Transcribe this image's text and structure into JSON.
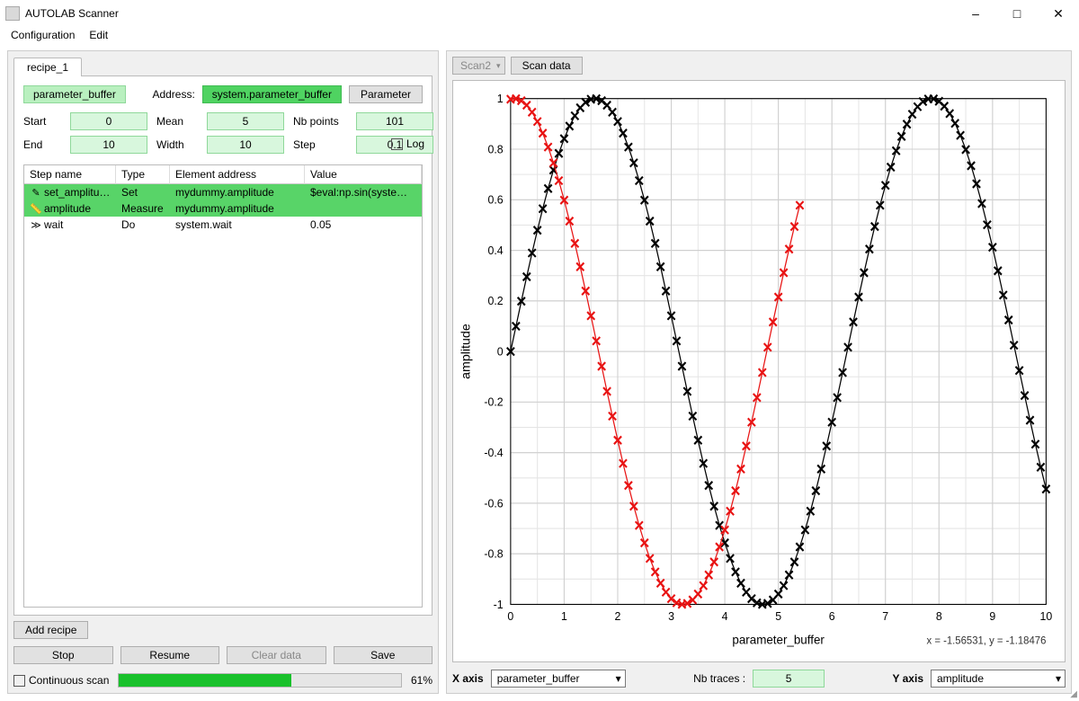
{
  "window": {
    "title": "AUTOLAB Scanner"
  },
  "menus": {
    "configuration": "Configuration",
    "edit": "Edit"
  },
  "tabs": {
    "active": "recipe_1"
  },
  "param_header": {
    "buffer_chip": "parameter_buffer",
    "address_label": "Address:",
    "address_value": "system.parameter_buffer",
    "parameter_button": "Parameter"
  },
  "params": {
    "start_label": "Start",
    "start": "0",
    "mean_label": "Mean",
    "mean": "5",
    "nb_points_label": "Nb points",
    "nb_points": "101",
    "end_label": "End",
    "end": "10",
    "width_label": "Width",
    "width": "10",
    "step_label": "Step",
    "step": "0.1",
    "log_label": "Log"
  },
  "steps": {
    "headers": {
      "name": "Step name",
      "type": "Type",
      "addr": "Element address",
      "value": "Value"
    },
    "rows": [
      {
        "icon": "✎",
        "name": "set_amplitu…",
        "type": "Set",
        "addr": "mydummy.amplitude",
        "value": "$eval:np.sin(system.p…",
        "selected": true
      },
      {
        "icon": "📏",
        "name": "amplitude",
        "type": "Measure",
        "addr": "mydummy.amplitude",
        "value": "",
        "selected": true
      },
      {
        "icon": "≫",
        "name": "wait",
        "type": "Do",
        "addr": "system.wait",
        "value": "0.05",
        "selected": false
      }
    ]
  },
  "buttons": {
    "add_recipe": "Add recipe",
    "stop": "Stop",
    "resume": "Resume",
    "clear_data": "Clear data",
    "save": "Save"
  },
  "continuous": {
    "label": "Continuous scan",
    "percent": 61,
    "percent_text": "61%"
  },
  "plot_toolbar": {
    "scan_select": "Scan2",
    "scan_data": "Scan data"
  },
  "axes": {
    "x_label": "X axis",
    "x_value": "parameter_buffer",
    "nb_traces_label": "Nb traces :",
    "nb_traces": "5",
    "y_label": "Y axis",
    "y_value": "amplitude"
  },
  "cursor_readout": "x = -1.56531, y = -1.18476",
  "chart_data": {
    "type": "line",
    "title": "",
    "xlabel": "parameter_buffer",
    "ylabel": "amplitude",
    "xlim": [
      0,
      10
    ],
    "ylim": [
      -1,
      1
    ],
    "xticks": [
      0,
      1,
      2,
      3,
      4,
      5,
      6,
      7,
      8,
      9,
      10
    ],
    "yticks": [
      -1,
      -0.8,
      -0.6,
      -0.4,
      -0.2,
      0,
      0.2,
      0.4,
      0.6,
      0.8,
      1
    ],
    "series": [
      {
        "name": "trace1",
        "color": "#000000",
        "x_start": 0,
        "x_step": 0.1,
        "n": 101,
        "values": [
          0.0,
          0.0998,
          0.1987,
          0.2955,
          0.3894,
          0.4794,
          0.5646,
          0.6442,
          0.7174,
          0.7833,
          0.8415,
          0.8912,
          0.932,
          0.9636,
          0.9854,
          0.9975,
          0.9996,
          0.9917,
          0.9738,
          0.9463,
          0.9093,
          0.8632,
          0.8085,
          0.7457,
          0.6755,
          0.5985,
          0.5155,
          0.4274,
          0.335,
          0.2392,
          0.1411,
          0.0416,
          -0.0584,
          -0.1577,
          -0.2555,
          -0.3508,
          -0.4425,
          -0.5298,
          -0.6119,
          -0.6878,
          -0.7568,
          -0.8183,
          -0.8716,
          -0.9162,
          -0.9516,
          -0.9775,
          -0.9937,
          -0.9999,
          -0.9962,
          -0.9825,
          -0.9589,
          -0.9258,
          -0.8835,
          -0.8323,
          -0.7728,
          -0.7055,
          -0.6313,
          -0.5507,
          -0.4646,
          -0.3739,
          -0.2794,
          -0.1822,
          -0.0831,
          0.0168,
          0.1165,
          0.2151,
          0.3115,
          0.4048,
          0.4941,
          0.5784,
          0.657,
          0.729,
          0.7937,
          0.8504,
          0.8987,
          0.938,
          0.9679,
          0.9882,
          0.9985,
          0.9989,
          0.9894,
          0.9699,
          0.9407,
          0.9022,
          0.8546,
          0.7985,
          0.7344,
          0.663,
          0.5849,
          0.501,
          0.4121,
          0.3191,
          0.2229,
          0.1245,
          0.0248,
          -0.0752,
          -0.1743,
          -0.2718,
          -0.3665,
          -0.4575,
          -0.544
        ]
      },
      {
        "name": "trace2",
        "color": "#e81313",
        "x_start": 0,
        "x_step": 0.1,
        "n": 55,
        "values": [
          0.9975,
          0.9996,
          0.9917,
          0.9738,
          0.9463,
          0.9093,
          0.8632,
          0.8085,
          0.7457,
          0.6755,
          0.5985,
          0.5155,
          0.4274,
          0.335,
          0.2392,
          0.1411,
          0.0416,
          -0.0584,
          -0.1577,
          -0.2555,
          -0.3508,
          -0.4425,
          -0.5298,
          -0.6119,
          -0.6878,
          -0.7568,
          -0.8183,
          -0.8716,
          -0.9162,
          -0.9516,
          -0.9775,
          -0.9937,
          -0.9999,
          -0.9962,
          -0.9825,
          -0.9589,
          -0.9258,
          -0.8835,
          -0.8323,
          -0.7728,
          -0.7055,
          -0.6313,
          -0.5507,
          -0.4646,
          -0.3739,
          -0.2794,
          -0.1822,
          -0.0831,
          0.0168,
          0.1165,
          0.2151,
          0.3115,
          0.4048,
          0.4941,
          0.5784
        ]
      }
    ]
  }
}
